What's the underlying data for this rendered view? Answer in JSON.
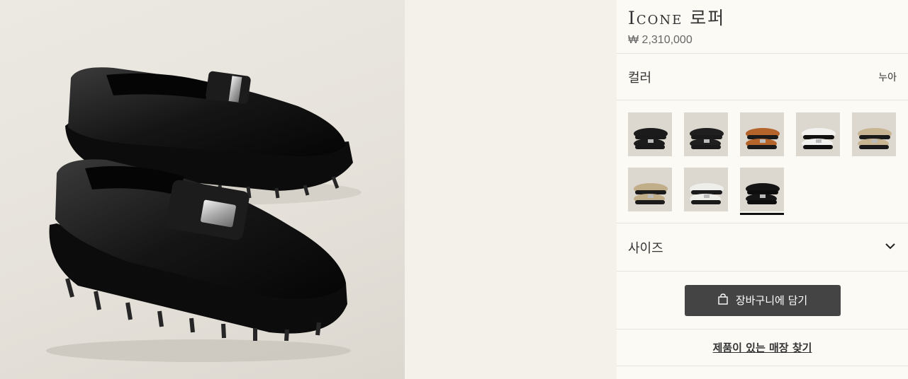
{
  "product": {
    "title": "Icone 로퍼",
    "price": "₩ 2,310,000"
  },
  "color": {
    "label": "컬러",
    "selected_value": "누아",
    "swatches": [
      {
        "variant": "black-brown-sole",
        "body": "#1c1c1c",
        "sole": "#1a1a1a",
        "bg": "#dcd8d0"
      },
      {
        "variant": "black-white-detail",
        "body": "#1f1f1f",
        "sole": "#1a1a1a",
        "bg": "#dcd8d0"
      },
      {
        "variant": "tan",
        "body": "#b5642c",
        "sole": "#1a1a1a",
        "bg": "#dcd8d0"
      },
      {
        "variant": "white",
        "body": "#f2f2f0",
        "sole": "#111111",
        "bg": "#dcd8d0"
      },
      {
        "variant": "beige-suede",
        "body": "#c9b592",
        "sole": "#1a1a1a",
        "bg": "#dcd8d0"
      },
      {
        "variant": "beige-black",
        "body": "#c2ad89",
        "sole": "#1a1a1a",
        "bg": "#dcd8d0"
      },
      {
        "variant": "white-black",
        "body": "#eeeeea",
        "sole": "#1a1a1a",
        "bg": "#dcd8d0"
      },
      {
        "variant": "black",
        "body": "#151515",
        "sole": "#0d0d0d",
        "bg": "#dcd8d0",
        "selected": true
      }
    ]
  },
  "size": {
    "label": "사이즈",
    "icon": "chevron-down-icon"
  },
  "cart": {
    "label": "장바구니에 담기",
    "icon": "shopping-bag-icon",
    "bg_color": "#444444"
  },
  "store": {
    "label": "제품이 있는 매장 찾기"
  }
}
